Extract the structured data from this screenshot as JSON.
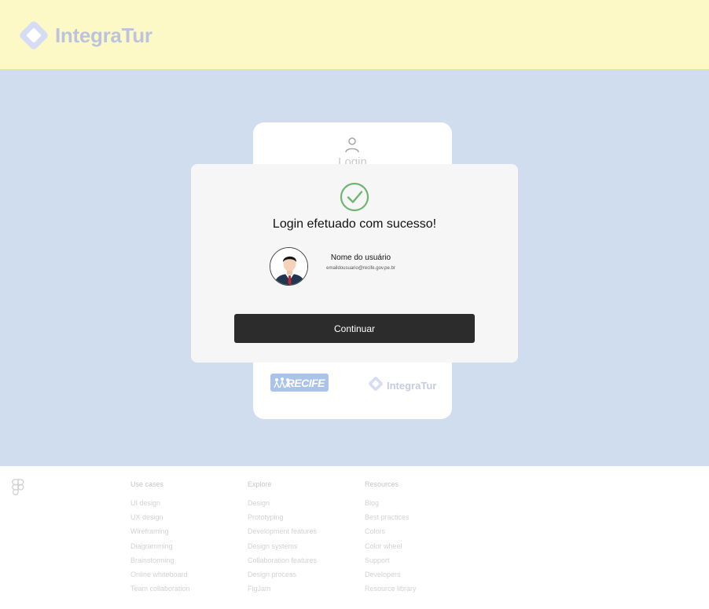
{
  "header": {
    "brand": "IntegraTur"
  },
  "login_card": {
    "title": "Login",
    "logos": {
      "recife": "RECIFE",
      "integratur": "IntegraTur"
    }
  },
  "modal": {
    "title": "Login efetuado com sucesso!",
    "user_name": "Nome do usuário",
    "user_email": "emaildousuario@recife.gov.pe.br",
    "continue_label": "Continuar"
  },
  "footer": {
    "columns": [
      {
        "title": "Use cases",
        "items": [
          "UI design",
          "UX design",
          "Wireframing",
          "Diagramming",
          "Brainstorming",
          "Online whiteboard",
          "Team collaboration"
        ]
      },
      {
        "title": "Explore",
        "items": [
          "Design",
          "Prototyping",
          "Development features",
          "Design systems",
          "Collaboration features",
          "Design process",
          "FigJam"
        ]
      },
      {
        "title": "Resources",
        "items": [
          "Blog",
          "Best practices",
          "Colors",
          "Color wheel",
          "Support",
          "Developers",
          "Resource library"
        ]
      }
    ]
  },
  "colors": {
    "header_bg": "#fdf9c7",
    "main_bg": "#cfddee",
    "button_bg": "#2c2c2c",
    "success_green": "#6cb66e",
    "brand_muted": "#bcc3dd"
  }
}
